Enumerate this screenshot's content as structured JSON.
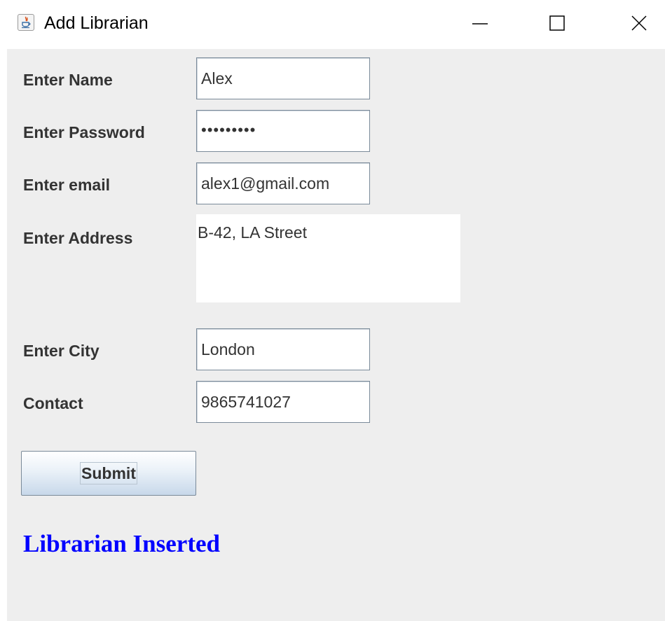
{
  "window": {
    "title": "Add Librarian",
    "icon": "java-icon"
  },
  "form": {
    "name_label": "Enter Name",
    "name_value": "Alex",
    "password_label": "Enter Password",
    "password_value": "•••••••••",
    "email_label": "Enter email",
    "email_value": "alex1@gmail.com",
    "address_label": "Enter Address",
    "address_value": "B-42, LA Street",
    "city_label": "Enter City",
    "city_value": "London",
    "contact_label": "Contact",
    "contact_value": "9865741027",
    "submit_label": "Submit"
  },
  "status": {
    "message": "Librarian Inserted",
    "color": "#0000ff"
  },
  "colors": {
    "window_bg": "#eeeeee",
    "field_border": "#7a8a99",
    "label_text": "#333333"
  }
}
